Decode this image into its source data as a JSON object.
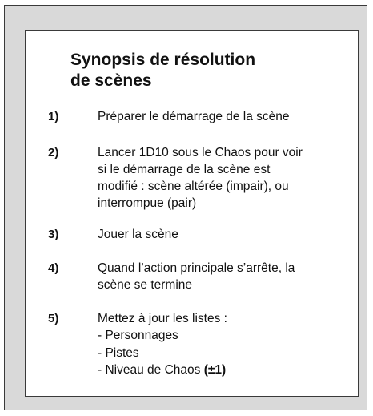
{
  "title": {
    "line1": "Synopsis de résolution",
    "line2": "de scènes"
  },
  "steps": [
    {
      "number": "1)",
      "lines": [
        "Préparer le démarrage de la scène"
      ]
    },
    {
      "number": "2)",
      "lines": [
        "Lancer 1D10 sous le Chaos pour voir",
        "si le démarrage de la scène est",
        "modifié : scène altérée (impair), ou",
        "interrompue (pair)"
      ]
    },
    {
      "number": "3)",
      "lines": [
        "Jouer la scène"
      ]
    },
    {
      "number": "4)",
      "lines": [
        "Quand l’action principale s’arrête, la",
        "scène se termine"
      ]
    },
    {
      "number": "5)",
      "lines": [
        "Mettez à jour les listes :"
      ],
      "sublist": [
        "- Personnages",
        "- Pistes",
        "- Niveau de Chaos "
      ],
      "sublist_suffix": "(±1)"
    }
  ]
}
